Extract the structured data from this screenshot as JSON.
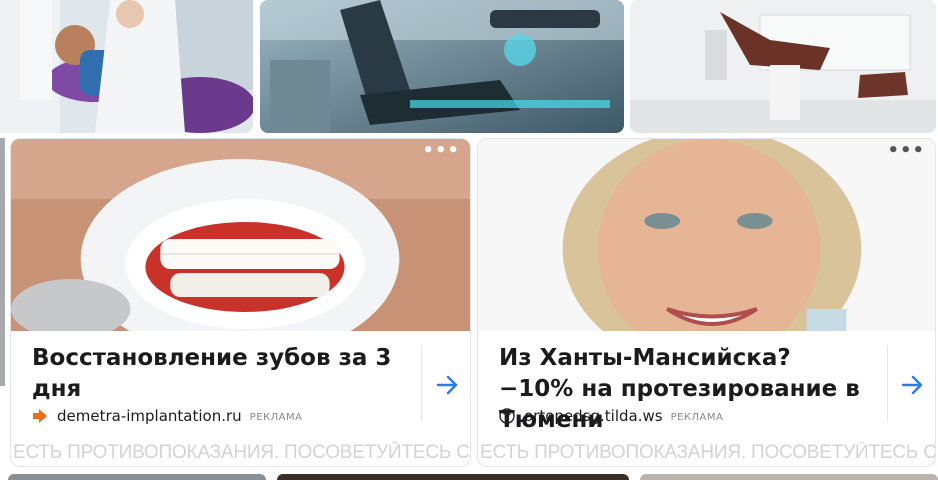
{
  "ads": [
    {
      "title": "Восстановление зубов за 3 дня",
      "domain": "demetra-implantation.ru",
      "ad_label": "РЕКЛАМА",
      "disclaimer": "ЕСТЬ ПРОТИВОПОКАЗАНИЯ. ПОСОВЕТУЙТЕСЬ С ВРАЧОМ",
      "favicon": "orange-arrow-icon"
    },
    {
      "title": "Из Ханты-Мансийска? −10% на протезирование в Тюмени",
      "domain": "ortopedsg.tilda.ws",
      "ad_label": "РЕКЛАМА",
      "disclaimer": "ЕСТЬ ПРОТИВОПОКАЗАНИЯ. ПОСОВЕТУЙТЕСЬ С ВРАЧОМ",
      "favicon": "tilda-t-icon"
    }
  ],
  "colors": {
    "accent_arrow": "#2f7be5",
    "disclaimer": "#d3d3d6"
  }
}
